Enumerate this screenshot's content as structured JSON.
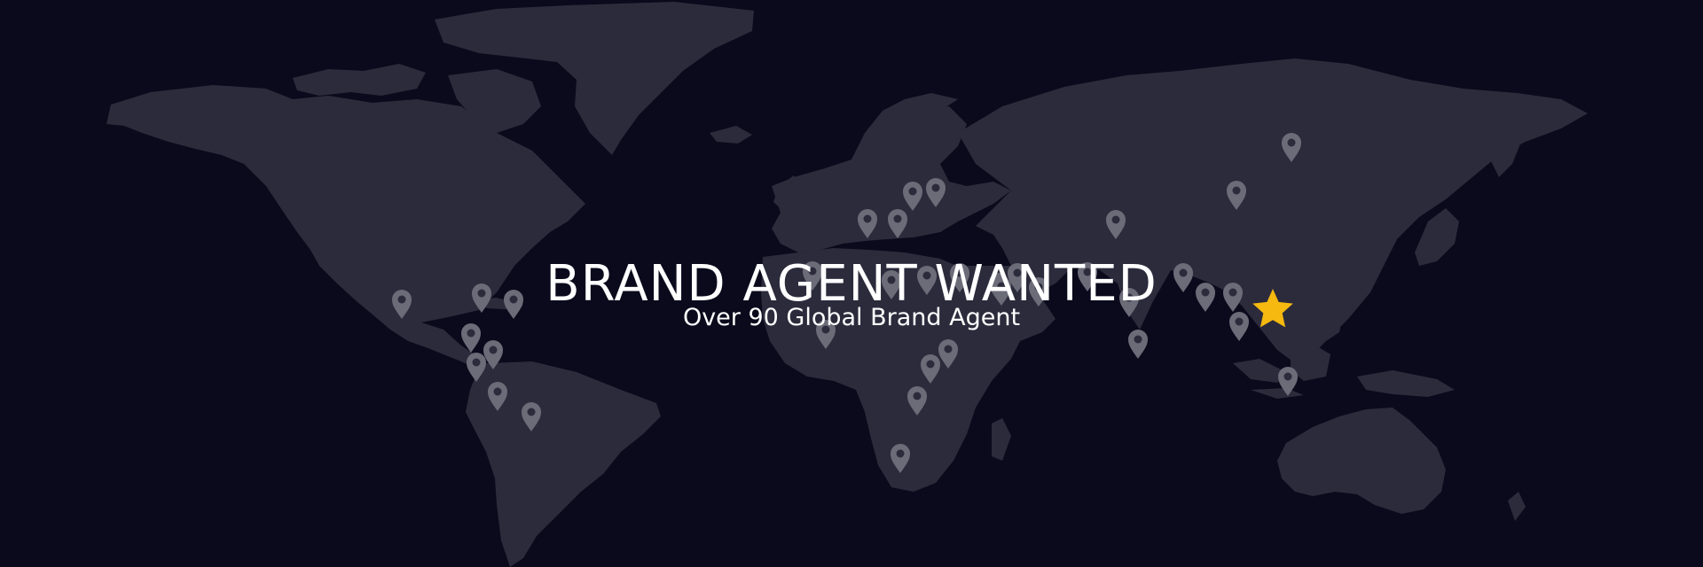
{
  "banner": {
    "title": "BRAND AGENT WANTED",
    "subtitle": "Over 90 Global Brand Agent"
  },
  "colors": {
    "background": "#0a0a1c",
    "land": "#2c2b3c",
    "pin": "#6c6b78",
    "headquarters_star": "#f5b90f",
    "text": "#ffffff"
  },
  "map": {
    "agent_pin_icon": "map-pin-icon",
    "headquarters_icon": "star-icon"
  }
}
